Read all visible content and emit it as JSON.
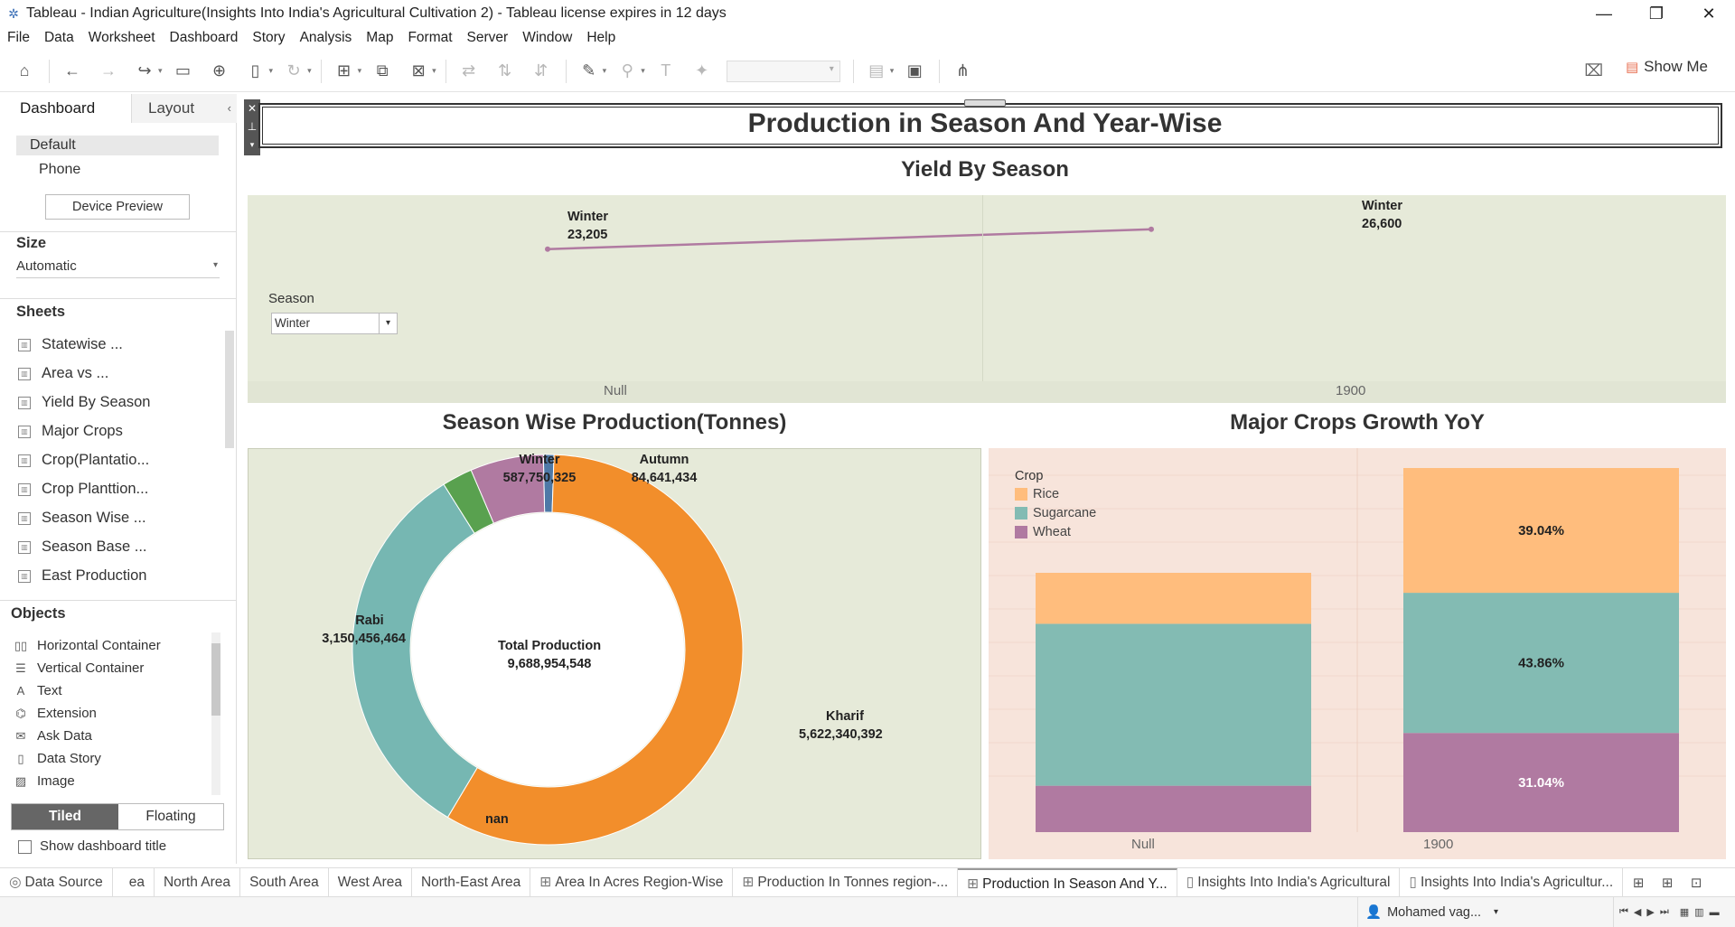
{
  "window": {
    "title": "Tableau - Indian Agriculture(Insights Into India's Agricultural Cultivation 2) - Tableau license expires in 12 days"
  },
  "menu": [
    "File",
    "Data",
    "Worksheet",
    "Dashboard",
    "Story",
    "Analysis",
    "Map",
    "Format",
    "Server",
    "Window",
    "Help"
  ],
  "toolbar": {
    "show_me_label": "Show Me"
  },
  "left_panel": {
    "tab_dashboard": "Dashboard",
    "tab_layout": "Layout",
    "device_default": "Default",
    "device_phone": "Phone",
    "device_preview_button": "Device Preview",
    "size_title": "Size",
    "size_value": "Automatic",
    "sheets_title": "Sheets",
    "sheets": [
      "Statewise ...",
      "Area vs ...",
      "Yield By Season",
      "Major Crops",
      "Crop(Plantatio...",
      "Crop Planttion...",
      "Season Wise ...",
      "Season Base ...",
      "East Production"
    ],
    "objects_title": "Objects",
    "objects": [
      "Horizontal Container",
      "Vertical Container",
      "Text",
      "Extension",
      "Ask Data",
      "Data Story",
      "Image"
    ],
    "tiled_label": "Tiled",
    "floating_label": "Floating",
    "show_title_label": "Show dashboard title"
  },
  "dashboard": {
    "title": "Production in Season And Year-Wise",
    "yield_chart_title": "Yield By Season",
    "season_filter_label": "Season",
    "season_filter_value": "Winter",
    "pie_chart_title": "Season Wise Production(Tonnes)",
    "pie_center_label": "Total Production",
    "pie_center_value": "9,688,954,548",
    "bar_chart_title": "Major Crops Growth YoY",
    "legend_title": "Crop"
  },
  "chart_data": [
    {
      "type": "line",
      "title": "Yield By Season",
      "categories": [
        "Null",
        "1900"
      ],
      "series": [
        {
          "name": "Winter",
          "values": [
            23205,
            26600
          ]
        }
      ],
      "point_labels": [
        [
          "Winter",
          "23,205"
        ],
        [
          "Winter",
          "26,600"
        ]
      ],
      "grid": false
    },
    {
      "type": "pie",
      "title": "Season Wise Production(Tonnes)",
      "donut": true,
      "slices": [
        {
          "label": "Kharif",
          "value_text": "5,622,340,392",
          "value": 5622340392,
          "color": "#f28e2b"
        },
        {
          "label": "Rabi",
          "value_text": "3,150,456,464",
          "value": 3150456464,
          "color": "#76b7b2"
        },
        {
          "label": "nan",
          "value_text": "",
          "value": 243765935,
          "color": "#59a14f"
        },
        {
          "label": "Winter",
          "value_text": "587,750,325",
          "value": 587750325,
          "color": "#b07aa1"
        },
        {
          "label": "Autumn",
          "value_text": "84,641,434",
          "value": 84641434,
          "color": "#4e79a7"
        }
      ]
    },
    {
      "type": "bar",
      "stacked": true,
      "normalized": true,
      "title": "Major Crops Growth YoY",
      "categories": [
        "Null",
        "1900"
      ],
      "series": [
        {
          "name": "Wheat",
          "color": "#b07aa1",
          "values": [
            0.1806,
            0.3104
          ],
          "labels": [
            "",
            "31.04%"
          ]
        },
        {
          "name": "Sugarcane",
          "color": "#83bbb3",
          "values": [
            0.6304,
            0.4386
          ],
          "labels": [
            "",
            "43.86%"
          ]
        },
        {
          "name": "Rice",
          "color": "#ffbd7d",
          "values": [
            0.1984,
            0.3904
          ],
          "labels": [
            "",
            "39.04%"
          ]
        }
      ],
      "legend": "top-left"
    }
  ],
  "bottom_tabs": [
    "Data Source",
    "ea",
    "North Area",
    "South Area",
    "West Area",
    "North-East Area",
    "Area In Acres Region-Wise",
    "Production In Tonnes region-...",
    "Production In Season And Y...",
    "Insights Into India's Agricultural",
    "Insights Into India's Agricultur..."
  ],
  "status": {
    "user": "Mohamed vag..."
  }
}
